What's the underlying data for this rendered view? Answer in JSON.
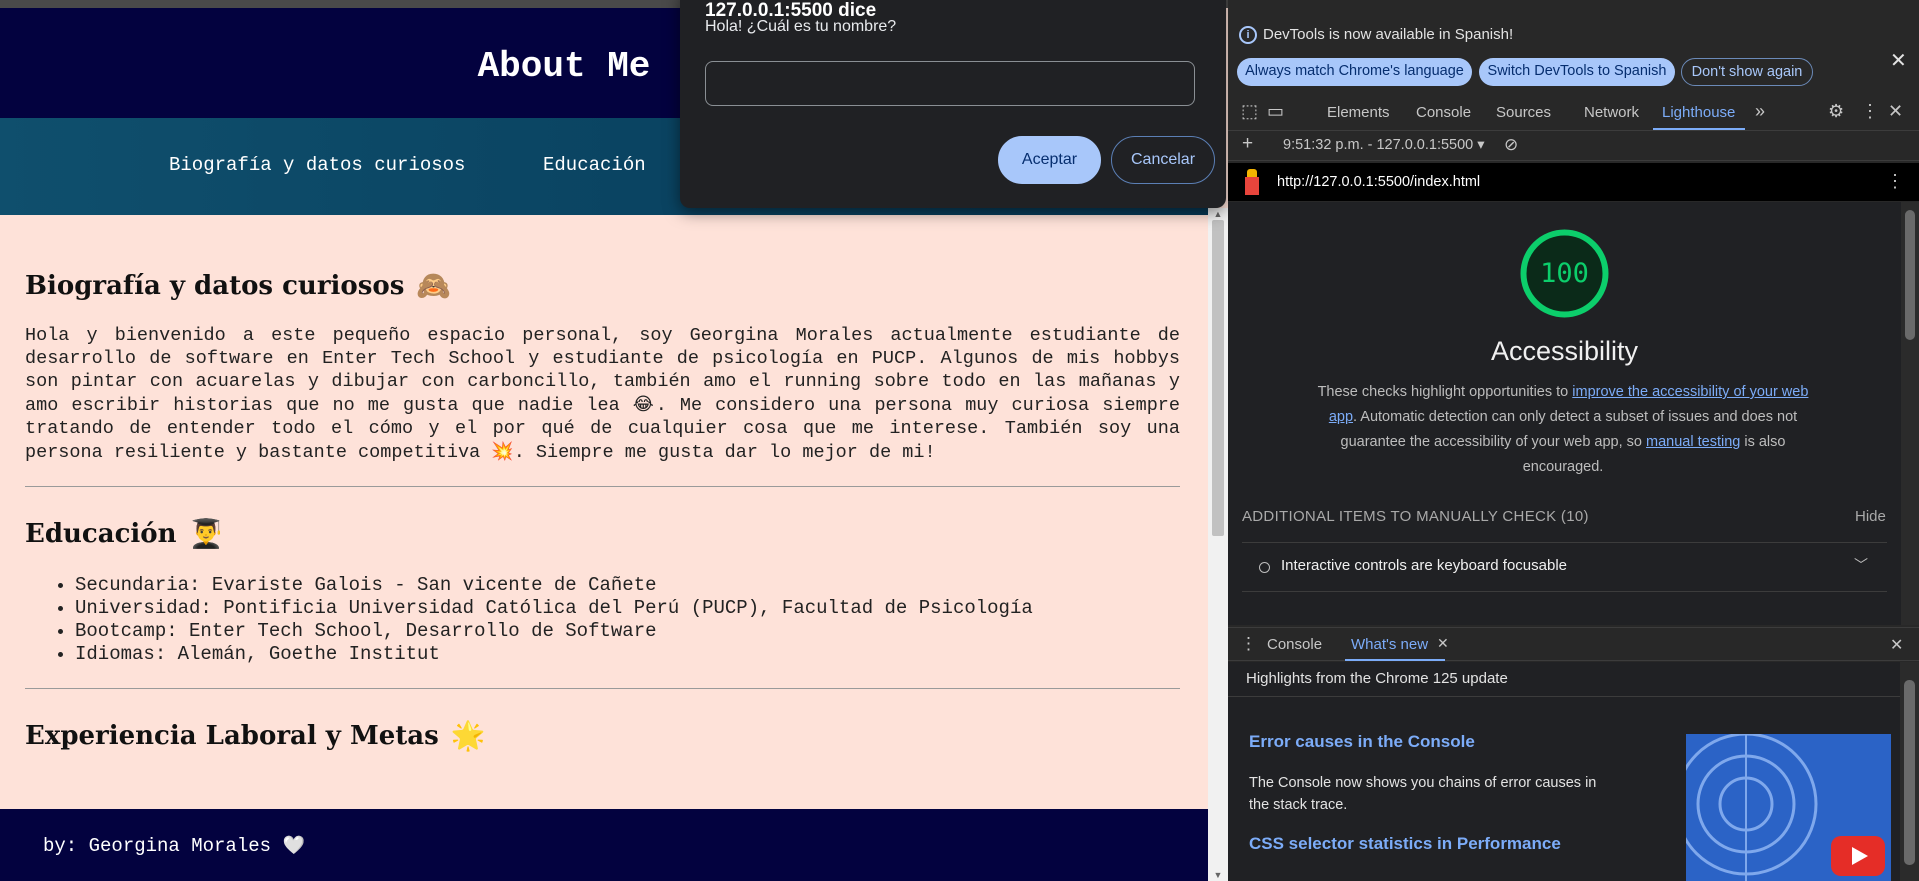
{
  "page": {
    "site_title": "About Me",
    "nav": [
      "Biografía y datos curiosos",
      "Educación"
    ],
    "sections": {
      "bio": {
        "title": "Biografía y datos curiosos",
        "emoji": "🙈",
        "text_1": "Hola y bienvenido a este pequeño espacio personal, soy Georgina Morales actualmente estudiante de desarrollo de software en Enter Tech School y estudiante de psicología en PUCP. Algunos de mis hobbys son pintar con acuarelas y dibujar con carboncillo, también amo el running sobre todo en las mañanas y amo escribir historias que no me gusta que nadie lea",
        "emoji_1": "😂",
        "text_2": ". Me considero una persona muy curiosa siempre tratando de entender todo el cómo y el por qué de cualquier cosa que me interese. También soy una persona resiliente y bastante competitiva",
        "emoji_2": "💥",
        "text_3": ". Siempre me gusta dar lo mejor de mi!"
      },
      "education": {
        "title": "Educación",
        "emoji": "👨‍🎓",
        "items": [
          "Secundaria: Evariste Galois - San vicente de Cañete",
          "Universidad: Pontificia Universidad Católica del Perú (PUCP), Facultad de Psicología",
          "Bootcamp: Enter Tech School, Desarrollo de Software",
          "Idiomas: Alemán, Goethe Institut"
        ]
      },
      "experience": {
        "title": "Experiencia Laboral y Metas",
        "emoji": "🌟"
      }
    },
    "footer": "by: Georgina Morales",
    "footer_emoji": "🤍"
  },
  "dialog": {
    "origin": "127.0.0.1:5500 dice",
    "message": "Hola! ¿Cuál es tu nombre?",
    "input_value": "",
    "accept": "Aceptar",
    "cancel": "Cancelar"
  },
  "devtools": {
    "infobar": {
      "text": "DevTools is now available in Spanish!",
      "btn_match": "Always match Chrome's language",
      "btn_switch": "Switch DevTools to Spanish",
      "btn_dont": "Don't show again"
    },
    "tabs": [
      "Elements",
      "Console",
      "Sources",
      "Network",
      "Lighthouse"
    ],
    "active_tab": "Lighthouse",
    "lh_toolbar": {
      "report": "9:51:32 p.m. - 127.0.0.1:5500"
    },
    "url": "http://127.0.0.1:5500/index.html",
    "report": {
      "score": "100",
      "category": "Accessibility",
      "desc_1": "These checks highlight opportunities to ",
      "link_1": "improve the accessibility of your web app",
      "desc_2": ". Automatic detection can only detect a subset of issues and does not guarantee the accessibility of your web app, so ",
      "link_2": "manual testing",
      "desc_3": " is also encouraged.",
      "manual_header": "ADDITIONAL ITEMS TO MANUALLY CHECK (10)",
      "hide": "Hide",
      "audit_1": "Interactive controls are keyboard focusable"
    },
    "drawer": {
      "tabs": [
        "Console",
        "What's new"
      ],
      "highlights": "Highlights from the Chrome 125 update",
      "item_1_title": "Error causes in the Console",
      "item_1_text": "The Console now shows you chains of error causes in the stack trace.",
      "item_2_title": "CSS selector statistics in Performance"
    },
    "colors": {
      "accent": "#7cacf8",
      "score_green": "#0cce6b"
    }
  }
}
